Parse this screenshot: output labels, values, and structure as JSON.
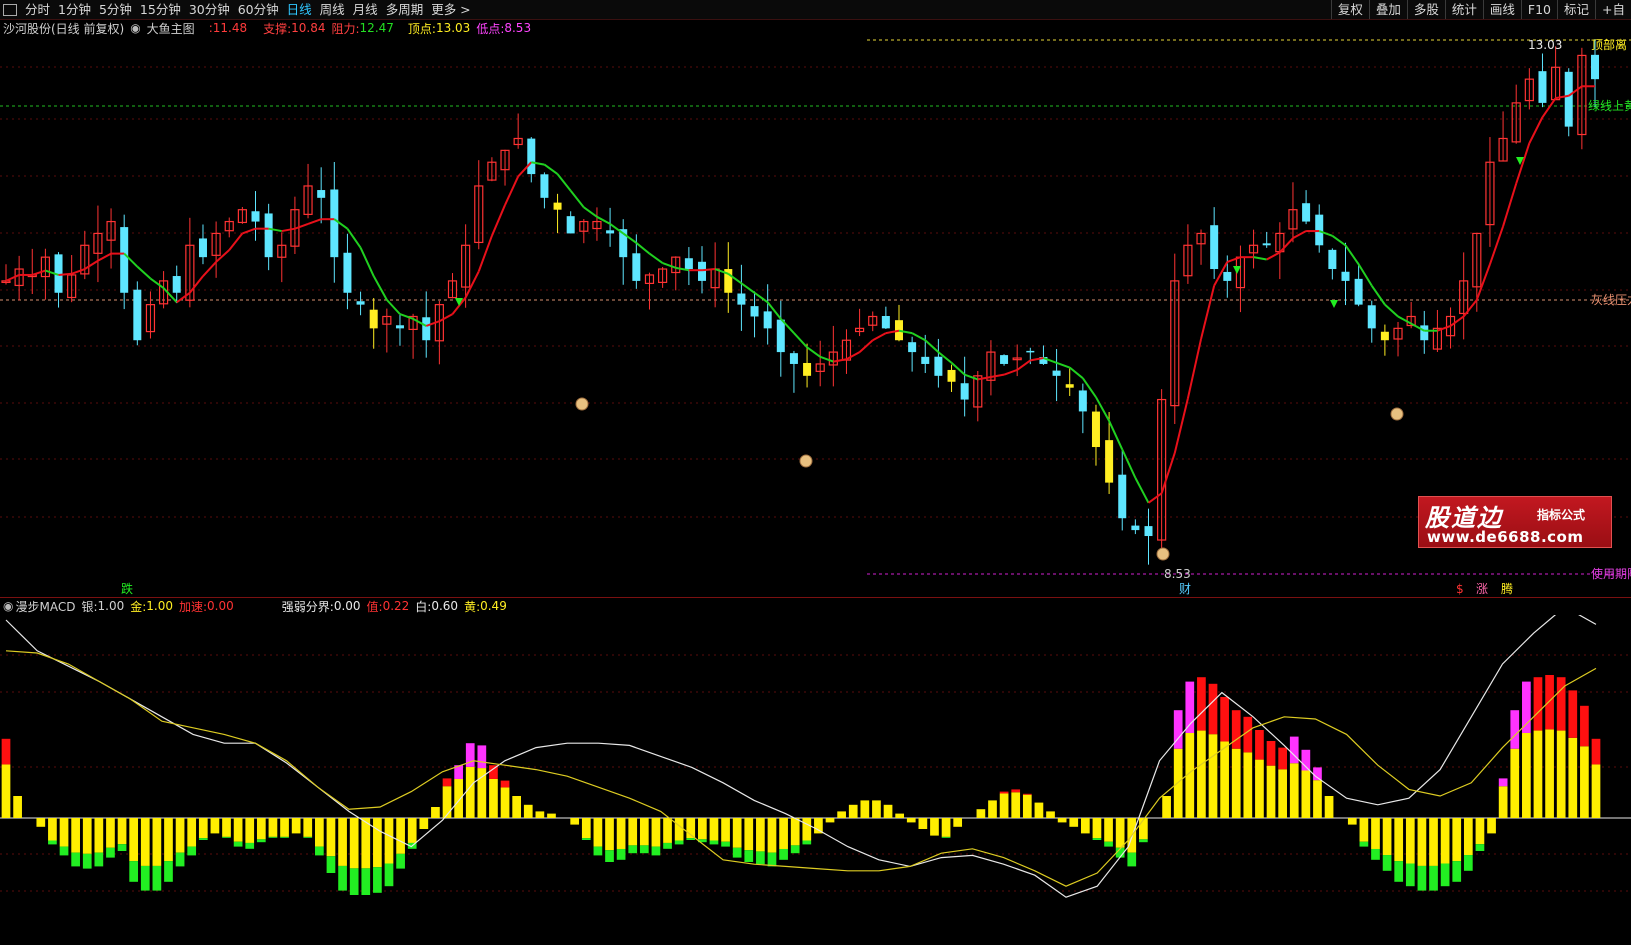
{
  "toolbar": {
    "periods": [
      "分时",
      "1分钟",
      "5分钟",
      "15分钟",
      "30分钟",
      "60分钟",
      "日线",
      "周线",
      "月线",
      "多周期",
      "更多 >"
    ],
    "active_period": "日线",
    "right_buttons": [
      "复权",
      "叠加",
      "多股",
      "统计",
      "画线",
      "F10",
      "标记",
      "+自"
    ]
  },
  "main_info": {
    "title": "沙河股份(日线 前复权)",
    "indicator": "大鱼主图",
    "price": ":11.48",
    "support_label": "支撑:",
    "support_value": "10.84",
    "resist_label": "阻力:",
    "resist_value": "12.47",
    "top_label": "顶点:",
    "top_value": "13.03",
    "low_label": "低点:",
    "low_value": "8.53"
  },
  "main_labels": {
    "high_price": "13.03",
    "low_price": "8.53",
    "right_top": "顶部离",
    "right_green": "绿线上黄",
    "right_gray": "灰线压力",
    "right_purple": "使用期限",
    "die": "跌",
    "cai": "财",
    "zhang": "涨",
    "teng": "腾",
    "dollar": "$"
  },
  "sub_info": {
    "name": "漫步MACD",
    "silver_label": "银:",
    "silver_value": "1.00",
    "gold_label": "金:",
    "gold_value": "1.00",
    "accel_label": "加速:",
    "accel_value": "0.00",
    "strength_label": "强弱分界:",
    "strength_value": "0.00",
    "value_label": "值:",
    "value_value": "0.22",
    "white_label": "白:",
    "white_value": "0.60",
    "yellow_label": "黄:",
    "yellow_value": "0.49"
  },
  "watermark": {
    "title": "股道边",
    "subtitle": "指标公式",
    "url": "www.de6688.com"
  },
  "colors": {
    "up": "#ff3333",
    "down": "#5ee6ff",
    "yellow_candle": "#ffee22",
    "ma_red": "#e8101a",
    "ma_green": "#20d020",
    "macd_yellow": "#ffee00",
    "macd_red": "#ff1010",
    "macd_magenta": "#ff33ff",
    "macd_green": "#22ee22"
  }
}
